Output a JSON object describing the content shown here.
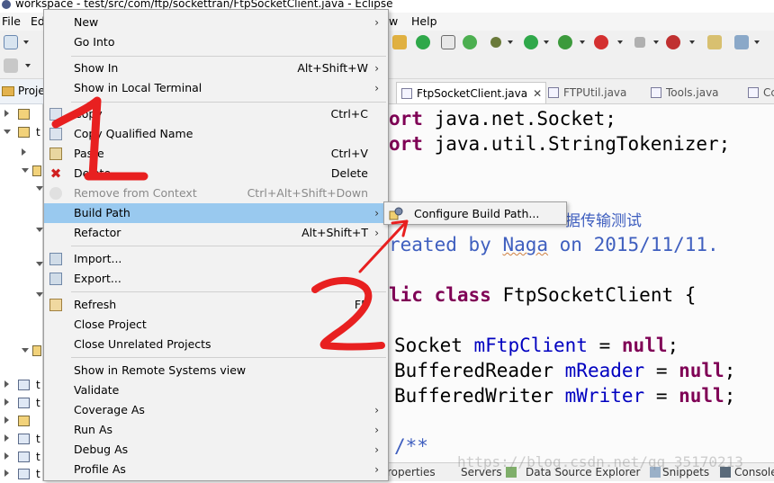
{
  "window": {
    "title": "workspace - test/src/com/ftp/sockettran/FtpSocketClient.java - Eclipse"
  },
  "menubar": {
    "file": "File",
    "edit": "Ed",
    "window": "w",
    "help": "Help"
  },
  "explorer": {
    "tab_label": "Proje",
    "row_label": "t"
  },
  "editor_tabs": [
    {
      "label": "FtpSocketClient.java",
      "close": "✕"
    },
    {
      "label": "FTPUtil.java"
    },
    {
      "label": "Tools.java"
    },
    {
      "label": "Cc"
    }
  ],
  "code": {
    "l1_kw": "ort",
    "l1_rest": " java.net.Socket;",
    "l2_kw": "ort",
    "l2_rest": " java.util.StringTokenizer;",
    "l3_comment": "据传输测试",
    "l4_a": "reated by ",
    "l4_name": "Naga",
    "l4_b": " on 2015/11/11.",
    "l5_kw1": "lic",
    "l5_kw2": "class",
    "l5_rest": " FtpSocketClient {",
    "l6_type": "Socket ",
    "l6_field": "mFtpClient",
    "l6_eq": " = ",
    "l6_null": "null",
    "l6_end": ";",
    "l7_type": "BufferedReader ",
    "l7_field": "mReader",
    "l7_eq": " = ",
    "l7_null": "null",
    "l7_end": ";",
    "l8_type": "BufferedWriter ",
    "l8_field": "mWriter",
    "l8_eq": " = ",
    "l8_null": "null",
    "l8_end": ";",
    "l9": "/**"
  },
  "context_menu": {
    "items": [
      {
        "label": "New",
        "accel": "",
        "submenu": true
      },
      {
        "label": "Go Into",
        "accel": ""
      },
      {
        "label": "Show In",
        "accel": "Alt+Shift+W",
        "submenu": true
      },
      {
        "label": "Show in Local Terminal",
        "accel": "",
        "submenu": true
      },
      {
        "label": "Copy",
        "accel": "Ctrl+C"
      },
      {
        "label": "Copy Qualified Name",
        "accel": ""
      },
      {
        "label": "Paste",
        "accel": "Ctrl+V"
      },
      {
        "label": "Delete",
        "accel": "Delete"
      },
      {
        "label": "Remove from Context",
        "accel": "Ctrl+Alt+Shift+Down",
        "disabled": true
      },
      {
        "label": "Build Path",
        "accel": "",
        "submenu": true,
        "highlighted": true
      },
      {
        "label": "Refactor",
        "accel": "Alt+Shift+T",
        "submenu": true
      },
      {
        "label": "Import...",
        "accel": ""
      },
      {
        "label": "Export...",
        "accel": ""
      },
      {
        "label": "Refresh",
        "accel": "F5"
      },
      {
        "label": "Close Project",
        "accel": ""
      },
      {
        "label": "Close Unrelated Projects",
        "accel": ""
      },
      {
        "label": "Show in Remote Systems view",
        "accel": ""
      },
      {
        "label": "Validate",
        "accel": ""
      },
      {
        "label": "Coverage As",
        "accel": "",
        "submenu": true
      },
      {
        "label": "Run As",
        "accel": "",
        "submenu": true
      },
      {
        "label": "Debug As",
        "accel": "",
        "submenu": true
      },
      {
        "label": "Profile As",
        "accel": "",
        "submenu": true
      }
    ],
    "submenu_arrow": "›"
  },
  "submenu": {
    "configure_build_path": "Configure Build Path..."
  },
  "bottom_tabs": {
    "properties": "roperties",
    "servers": "Servers",
    "data_source": "Data Source Explorer",
    "snippets": "Snippets",
    "console": "Console"
  },
  "watermark": "https://blog.csdn.net/qq_35170213",
  "annotations": {
    "step1": "1",
    "step2": "2"
  },
  "colors": {
    "highlight": "#99c9ef",
    "annotation_red": "#e82020",
    "keyword": "#7f0055",
    "field": "#0000c0",
    "comment": "#3f5fbf"
  }
}
